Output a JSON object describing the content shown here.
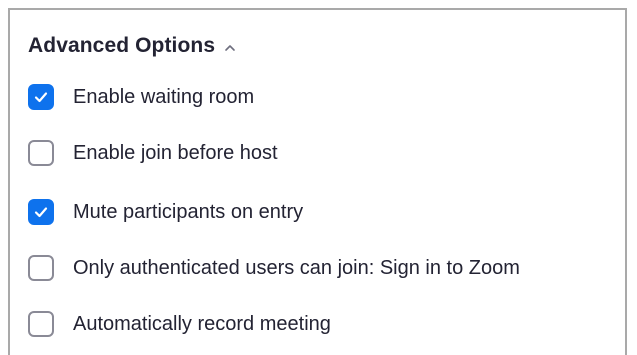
{
  "section": {
    "title": "Advanced Options",
    "collapse_icon": "chevron-up-icon"
  },
  "options": [
    {
      "label": "Enable waiting room",
      "checked": true
    },
    {
      "label": "Enable join before host",
      "checked": false
    },
    {
      "label": "Mute participants on entry",
      "checked": true
    },
    {
      "label": "Only authenticated users can join: Sign in to Zoom",
      "checked": false
    },
    {
      "label": "Automatically record meeting",
      "checked": false
    }
  ],
  "colors": {
    "accent": "#0e72ed",
    "text": "#232333",
    "checkbox_border": "#8a8a96",
    "frame_border": "#a9a9a9"
  }
}
